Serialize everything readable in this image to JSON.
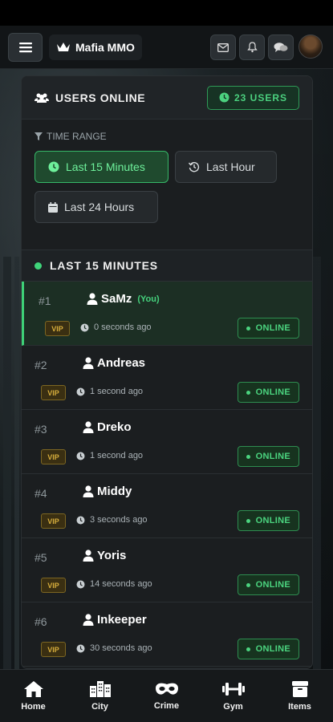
{
  "app": {
    "title": "Mafia MMO"
  },
  "card": {
    "title": "USERS ONLINE",
    "count_label": "23 USERS"
  },
  "filter": {
    "label": "TIME RANGE",
    "options": [
      {
        "label": "Last 15 Minutes",
        "active": true,
        "icon": "clock-icon"
      },
      {
        "label": "Last Hour",
        "active": false,
        "icon": "history-icon"
      },
      {
        "label": "Last 24 Hours",
        "active": false,
        "icon": "calendar-icon"
      }
    ]
  },
  "section": {
    "title": "LAST 15 MINUTES"
  },
  "users": [
    {
      "rank": "#1",
      "name": "SaMz",
      "you": "(You)",
      "badge": "VIP",
      "seen": "0 seconds ago",
      "status": "ONLINE"
    },
    {
      "rank": "#2",
      "name": "Andreas",
      "badge": "VIP",
      "seen": "1 second ago",
      "status": "ONLINE"
    },
    {
      "rank": "#3",
      "name": "Dreko",
      "badge": "VIP",
      "seen": "1 second ago",
      "status": "ONLINE"
    },
    {
      "rank": "#4",
      "name": "Middy",
      "badge": "VIP",
      "seen": "3 seconds ago",
      "status": "ONLINE"
    },
    {
      "rank": "#5",
      "name": "Yoris",
      "badge": "VIP",
      "seen": "14 seconds ago",
      "status": "ONLINE"
    },
    {
      "rank": "#6",
      "name": "Inkeeper",
      "badge": "VIP",
      "seen": "30 seconds ago",
      "status": "ONLINE"
    }
  ],
  "nav": {
    "items": [
      {
        "label": "Home",
        "icon": "home-icon"
      },
      {
        "label": "City",
        "icon": "city-icon"
      },
      {
        "label": "Crime",
        "icon": "mask-icon"
      },
      {
        "label": "Gym",
        "icon": "dumbbell-icon"
      },
      {
        "label": "Items",
        "icon": "items-box-icon"
      }
    ]
  },
  "colors": {
    "accent": "#3ed177",
    "vip": "#d7ae3c",
    "background": "#1b1e20"
  }
}
